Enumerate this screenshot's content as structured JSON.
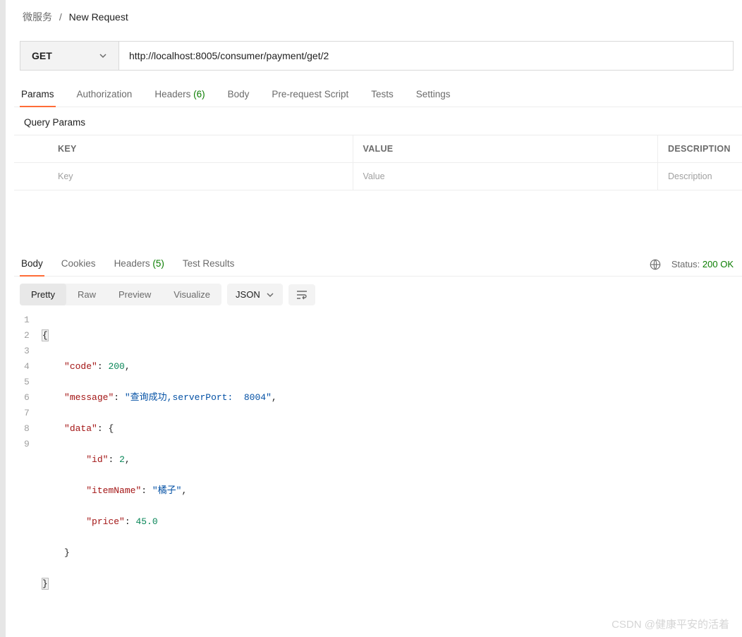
{
  "breadcrumb": {
    "parent": "微服务",
    "sep": "/",
    "current": "New Request"
  },
  "request": {
    "method": "GET",
    "url": "http://localhost:8005/consumer/payment/get/2"
  },
  "reqTabs": {
    "params": "Params",
    "auth": "Authorization",
    "headers": "Headers",
    "headersCount": "(6)",
    "body": "Body",
    "prereq": "Pre-request Script",
    "tests": "Tests",
    "settings": "Settings"
  },
  "queryParams": {
    "title": "Query Params",
    "cols": {
      "key": "KEY",
      "value": "VALUE",
      "desc": "DESCRIPTION"
    },
    "placeholders": {
      "key": "Key",
      "value": "Value",
      "desc": "Description"
    }
  },
  "respTabs": {
    "body": "Body",
    "cookies": "Cookies",
    "headers": "Headers",
    "headersCount": "(5)",
    "testResults": "Test Results"
  },
  "status": {
    "label": "Status:",
    "value": "200 OK"
  },
  "formatBar": {
    "pretty": "Pretty",
    "raw": "Raw",
    "preview": "Preview",
    "visualize": "Visualize",
    "lang": "JSON"
  },
  "responseBody": {
    "code": 200,
    "message": "查询成功,serverPort:  8004",
    "data": {
      "id": 2,
      "itemName": "橘子",
      "price": 45.0
    }
  },
  "codeLines": {
    "l1": "{",
    "l2a": "\"code\"",
    "l2b": "200",
    "l3a": "\"message\"",
    "l3b": "\"查询成功,serverPort:  8004\"",
    "l4a": "\"data\"",
    "l5a": "\"id\"",
    "l5b": "2",
    "l6a": "\"itemName\"",
    "l6b": "\"橘子\"",
    "l7a": "\"price\"",
    "l7b": "45.0",
    "l8": "}",
    "l9": "}"
  },
  "lineNums": {
    "n1": "1",
    "n2": "2",
    "n3": "3",
    "n4": "4",
    "n5": "5",
    "n6": "6",
    "n7": "7",
    "n8": "8",
    "n9": "9"
  },
  "watermark": "CSDN @健康平安的活着"
}
